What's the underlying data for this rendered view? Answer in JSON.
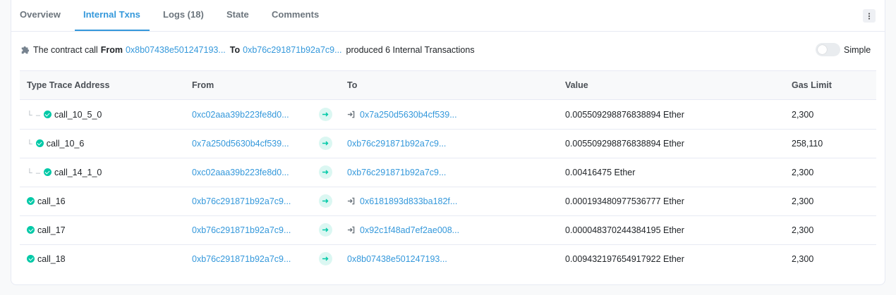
{
  "tabs": [
    {
      "label": "Overview"
    },
    {
      "label": "Internal Txns"
    },
    {
      "label": "Logs (18)"
    },
    {
      "label": "State"
    },
    {
      "label": "Comments"
    }
  ],
  "summary": {
    "prefix": "The contract call",
    "from_label": "From",
    "from_address": "0x8b07438e501247193...",
    "to_label": "To",
    "to_address": "0xb76c291871b92a7c9...",
    "suffix": "produced 6 Internal Transactions"
  },
  "toggle": {
    "label": "Simple"
  },
  "table": {
    "headers": {
      "type": "Type Trace Address",
      "from": "From",
      "to": "To",
      "value": "Value",
      "gas": "Gas Limit"
    },
    "rows": [
      {
        "tree": "└ –",
        "type": "call_10_5_0",
        "from": "0xc02aaa39b223fe8d0...",
        "to": "0x7a250d5630b4cf539...",
        "to_contract": true,
        "value": "0.005509298876838894 Ether",
        "gas": "2,300"
      },
      {
        "tree": "└",
        "type": "call_10_6",
        "from": "0x7a250d5630b4cf539...",
        "to": "0xb76c291871b92a7c9...",
        "to_contract": false,
        "value": "0.005509298876838894 Ether",
        "gas": "258,110"
      },
      {
        "tree": "└ –",
        "type": "call_14_1_0",
        "from": "0xc02aaa39b223fe8d0...",
        "to": "0xb76c291871b92a7c9...",
        "to_contract": false,
        "value": "0.00416475 Ether",
        "gas": "2,300"
      },
      {
        "tree": "",
        "type": "call_16",
        "from": "0xb76c291871b92a7c9...",
        "to": "0x6181893d833ba182f...",
        "to_contract": true,
        "value": "0.000193480977536777 Ether",
        "gas": "2,300"
      },
      {
        "tree": "",
        "type": "call_17",
        "from": "0xb76c291871b92a7c9...",
        "to": "0x92c1f48ad7ef2ae008...",
        "to_contract": true,
        "value": "0.000048370244384195 Ether",
        "gas": "2,300"
      },
      {
        "tree": "",
        "type": "call_18",
        "from": "0xb76c291871b92a7c9...",
        "to": "0x8b07438e501247193...",
        "to_contract": false,
        "value": "0.009432197654917922 Ether",
        "gas": "2,300"
      }
    ]
  },
  "colors": {
    "accent": "#3498db",
    "success": "#00c9a7"
  }
}
